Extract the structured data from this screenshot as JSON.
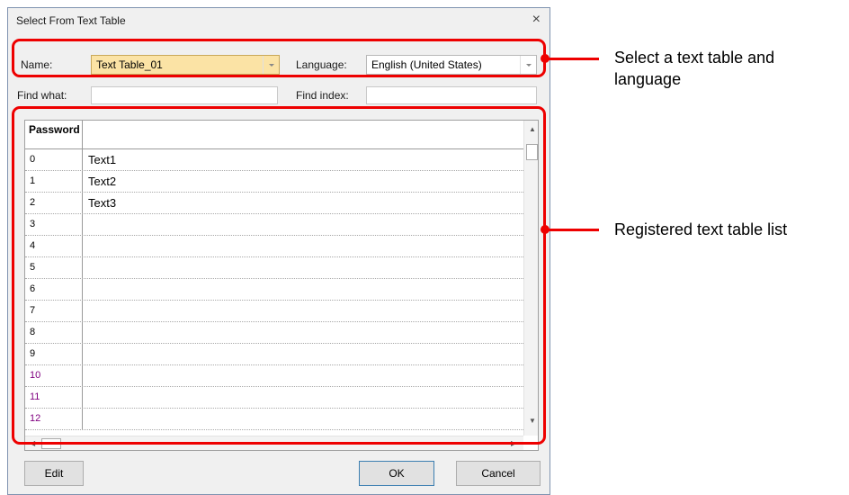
{
  "dialog": {
    "title": "Select From Text Table",
    "close_glyph": "×"
  },
  "name_field": {
    "label": "Name:",
    "value": "Text Table_01"
  },
  "language_field": {
    "label": "Language:",
    "value": "English (United States)"
  },
  "find_what": {
    "label": "Find what:",
    "value": ""
  },
  "find_index": {
    "label": "Find index:",
    "value": ""
  },
  "grid": {
    "header": "Password",
    "rows": [
      {
        "index": "0",
        "text": "Text1"
      },
      {
        "index": "1",
        "text": "Text2"
      },
      {
        "index": "2",
        "text": "Text3"
      },
      {
        "index": "3",
        "text": ""
      },
      {
        "index": "4",
        "text": ""
      },
      {
        "index": "5",
        "text": ""
      },
      {
        "index": "6",
        "text": ""
      },
      {
        "index": "7",
        "text": ""
      },
      {
        "index": "8",
        "text": ""
      },
      {
        "index": "9",
        "text": ""
      },
      {
        "index": "10",
        "text": ""
      },
      {
        "index": "11",
        "text": ""
      },
      {
        "index": "12",
        "text": ""
      }
    ]
  },
  "buttons": {
    "edit": "Edit",
    "ok": "OK",
    "cancel": "Cancel"
  },
  "callouts": {
    "select_table": "Select a text table and language",
    "registered_list": "Registered text table list"
  },
  "colors": {
    "highlight": "#ee0000",
    "name_combo_bg": "#fbe3a5",
    "index_purple": "#800080"
  },
  "icons": [
    "close-icon",
    "dropdown-arrow-icon",
    "scroll-up-icon",
    "scroll-down-icon",
    "scroll-left-icon",
    "scroll-right-icon"
  ]
}
